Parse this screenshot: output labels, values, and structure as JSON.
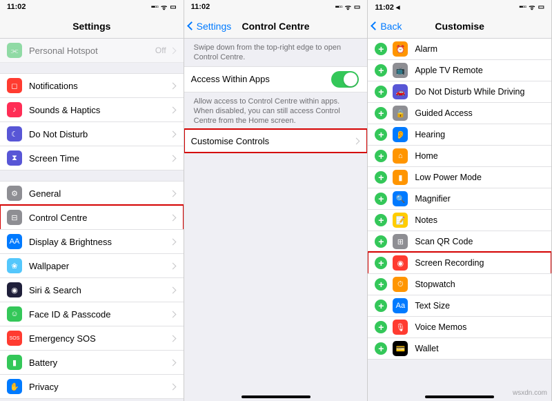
{
  "status": {
    "time": "11:02",
    "time3": "11:02 ◂",
    "signal": "▪▪▫▫",
    "wifi": "ᯤ",
    "battery": "▭"
  },
  "panel1": {
    "title": "Settings",
    "top_item": {
      "label": "Personal Hotspot",
      "value": "Off"
    },
    "groupA": [
      {
        "label": "Notifications",
        "iconColor": "#ff3b30",
        "glyph": "◻︎"
      },
      {
        "label": "Sounds & Haptics",
        "iconColor": "#ff2d55",
        "glyph": "♪"
      },
      {
        "label": "Do Not Disturb",
        "iconColor": "#5856d6",
        "glyph": "☾"
      },
      {
        "label": "Screen Time",
        "iconColor": "#5856d6",
        "glyph": "⧗"
      }
    ],
    "groupB": [
      {
        "label": "General",
        "iconColor": "#8e8e93",
        "glyph": "⚙"
      },
      {
        "label": "Control Centre",
        "iconColor": "#8e8e93",
        "glyph": "⊟",
        "hl": true
      },
      {
        "label": "Display & Brightness",
        "iconColor": "#007aff",
        "glyph": "AA"
      },
      {
        "label": "Wallpaper",
        "iconColor": "#54c7fc",
        "glyph": "❀"
      },
      {
        "label": "Siri & Search",
        "iconColor": "#1f1f3a",
        "glyph": "◉"
      },
      {
        "label": "Face ID & Passcode",
        "iconColor": "#34c759",
        "glyph": "☺"
      },
      {
        "label": "Emergency SOS",
        "iconColor": "#ff3b30",
        "glyph": "SOS"
      },
      {
        "label": "Battery",
        "iconColor": "#34c759",
        "glyph": "▮"
      },
      {
        "label": "Privacy",
        "iconColor": "#007aff",
        "glyph": "✋"
      }
    ]
  },
  "panel2": {
    "back": "Settings",
    "title": "Control Centre",
    "note1": "Swipe down from the top-right edge to open Control Centre.",
    "access": {
      "label": "Access Within Apps"
    },
    "note2": "Allow access to Control Centre within apps. When disabled, you can still access Control Centre from the Home screen.",
    "customise": {
      "label": "Customise Controls"
    }
  },
  "panel3": {
    "back": "Back",
    "title": "Customise",
    "items": [
      {
        "label": "Alarm",
        "iconColor": "#ff9500",
        "glyph": "⏰"
      },
      {
        "label": "Apple TV Remote",
        "iconColor": "#8e8e93",
        "glyph": "📺"
      },
      {
        "label": "Do Not Disturb While Driving",
        "iconColor": "#5856d6",
        "glyph": "🚗"
      },
      {
        "label": "Guided Access",
        "iconColor": "#8e8e93",
        "glyph": "🔒"
      },
      {
        "label": "Hearing",
        "iconColor": "#007aff",
        "glyph": "👂"
      },
      {
        "label": "Home",
        "iconColor": "#ff9500",
        "glyph": "⌂"
      },
      {
        "label": "Low Power Mode",
        "iconColor": "#ff9500",
        "glyph": "▮"
      },
      {
        "label": "Magnifier",
        "iconColor": "#007aff",
        "glyph": "🔍"
      },
      {
        "label": "Notes",
        "iconColor": "#ffcc00",
        "glyph": "📝"
      },
      {
        "label": "Scan QR Code",
        "iconColor": "#8e8e93",
        "glyph": "⊞"
      },
      {
        "label": "Screen Recording",
        "iconColor": "#ff3b30",
        "glyph": "◉",
        "hl": true
      },
      {
        "label": "Stopwatch",
        "iconColor": "#ff9500",
        "glyph": "⏱"
      },
      {
        "label": "Text Size",
        "iconColor": "#007aff",
        "glyph": "Aa"
      },
      {
        "label": "Voice Memos",
        "iconColor": "#ff3b30",
        "glyph": "🎙"
      },
      {
        "label": "Wallet",
        "iconColor": "#000000",
        "glyph": "💳"
      }
    ]
  },
  "watermark": "wsxdn.com"
}
